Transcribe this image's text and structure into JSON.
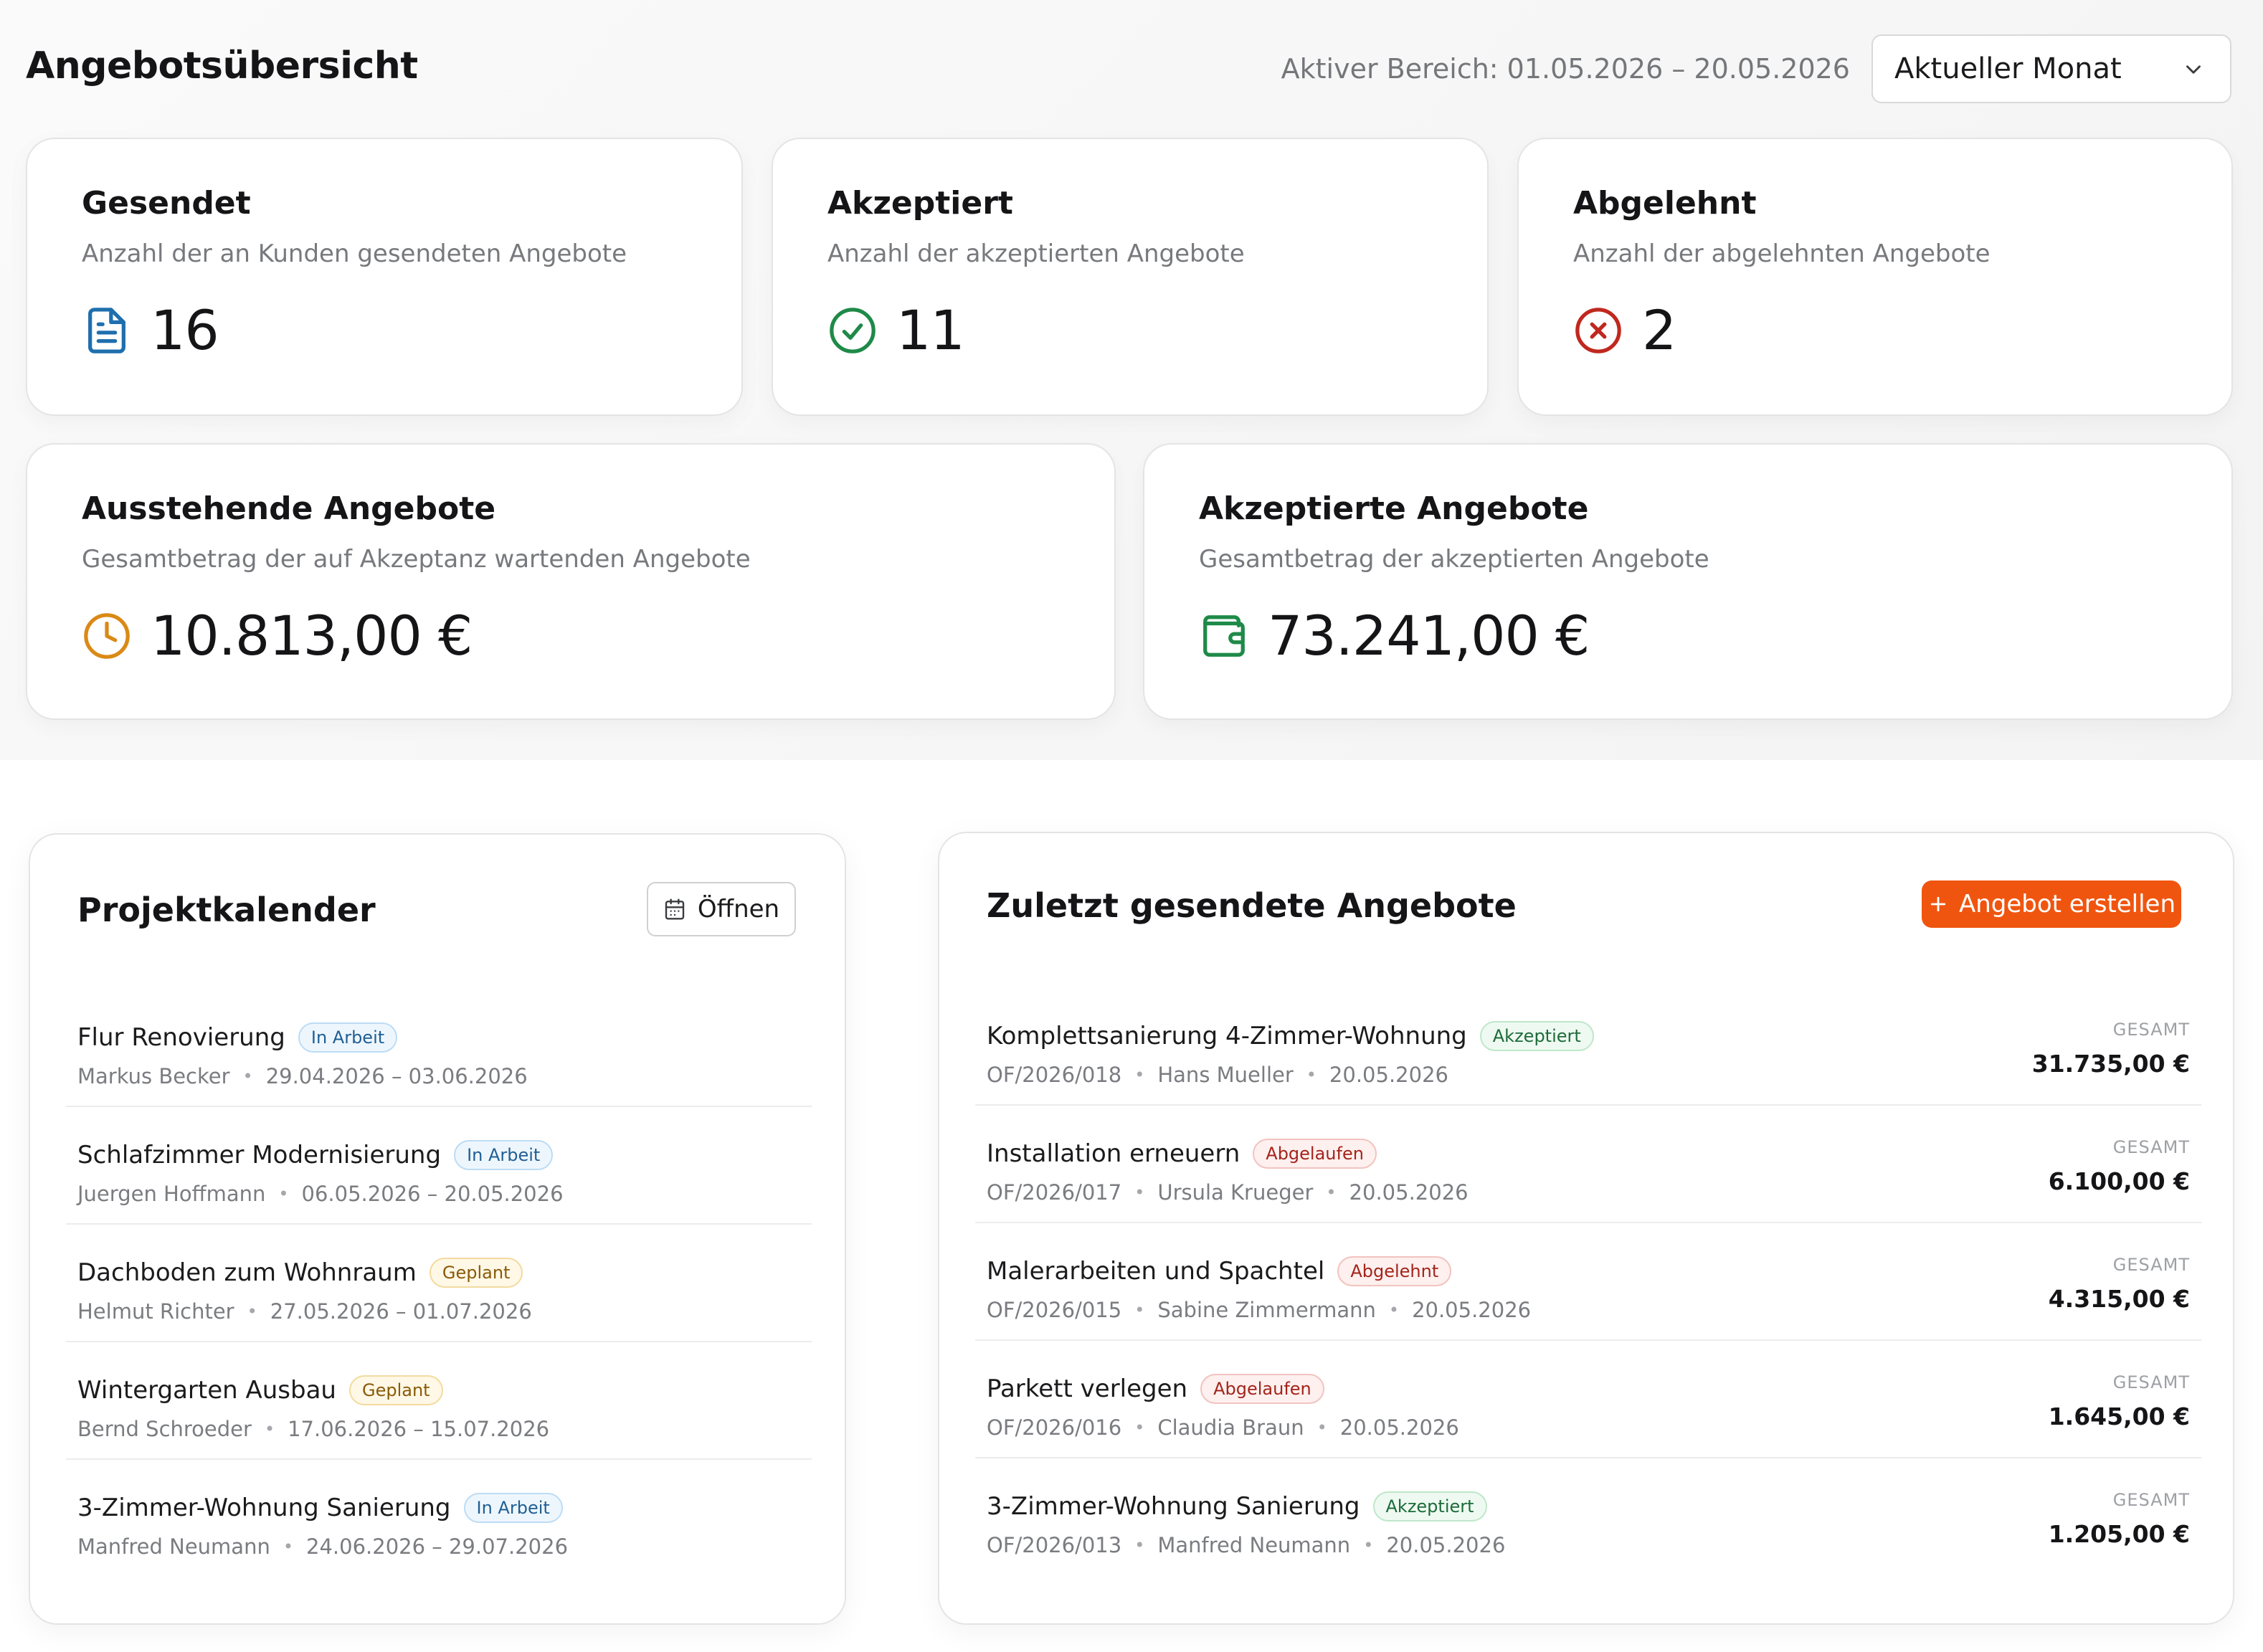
{
  "header": {
    "title": "Angebotsübersicht",
    "range_label": "Aktiver Bereich: 01.05.2026 – 20.05.2026",
    "period_select": "Aktueller Monat"
  },
  "stats": [
    {
      "title": "Gesendet",
      "subtitle": "Anzahl der an Kunden gesendeten Angebote",
      "value": "16",
      "icon": "document-icon",
      "color": "#1f6fae"
    },
    {
      "title": "Akzeptiert",
      "subtitle": "Anzahl der akzeptierten Angebote",
      "value": "11",
      "icon": "check-circle-icon",
      "color": "#1f8a48"
    },
    {
      "title": "Abgelehnt",
      "subtitle": "Anzahl der abgelehnten Angebote",
      "value": "2",
      "icon": "x-circle-icon",
      "color": "#c0281e"
    },
    {
      "title": "Ausstehende Angebote",
      "subtitle": "Gesamtbetrag der auf Akzeptanz wartenden Angebote",
      "value": "10.813,00 €",
      "icon": "clock-icon",
      "color": "#d98a16"
    },
    {
      "title": "Akzeptierte Angebote",
      "subtitle": "Gesamtbetrag der akzeptierten Angebote",
      "value": "73.241,00 €",
      "icon": "wallet-icon",
      "color": "#1f8a48"
    }
  ],
  "calendar": {
    "title": "Projektkalender",
    "open_label": "Öffnen",
    "items": [
      {
        "name": "Flur Renovierung",
        "status": "In Arbeit",
        "person": "Markus Becker",
        "dates": "29.04.2026 – 03.06.2026"
      },
      {
        "name": "Schlafzimmer Modernisierung",
        "status": "In Arbeit",
        "person": "Juergen Hoffmann",
        "dates": "06.05.2026 – 20.05.2026"
      },
      {
        "name": "Dachboden zum Wohnraum",
        "status": "Geplant",
        "person": "Helmut Richter",
        "dates": "27.05.2026 – 01.07.2026"
      },
      {
        "name": "Wintergarten Ausbau",
        "status": "Geplant",
        "person": "Bernd Schroeder",
        "dates": "17.06.2026 – 15.07.2026"
      },
      {
        "name": "3-Zimmer-Wohnung Sanierung",
        "status": "In Arbeit",
        "person": "Manfred Neumann",
        "dates": "24.06.2026 – 29.07.2026"
      }
    ]
  },
  "offers": {
    "title": "Zuletzt gesendete Angebote",
    "create_label": "Angebot erstellen",
    "total_label": "GESAMT",
    "items": [
      {
        "name": "Komplettsanierung 4-Zimmer-Wohnung",
        "status": "Akzeptiert",
        "number": "OF/2026/018",
        "customer": "Hans Mueller",
        "date": "20.05.2026",
        "total": "31.735,00 €"
      },
      {
        "name": "Installation erneuern",
        "status": "Abgelaufen",
        "number": "OF/2026/017",
        "customer": "Ursula Krueger",
        "date": "20.05.2026",
        "total": "6.100,00 €"
      },
      {
        "name": "Malerarbeiten und Spachtel",
        "status": "Abgelehnt",
        "number": "OF/2026/015",
        "customer": "Sabine Zimmermann",
        "date": "20.05.2026",
        "total": "4.315,00 €"
      },
      {
        "name": "Parkett verlegen",
        "status": "Abgelaufen",
        "number": "OF/2026/016",
        "customer": "Claudia Braun",
        "date": "20.05.2026",
        "total": "1.645,00 €"
      },
      {
        "name": "3-Zimmer-Wohnung Sanierung",
        "status": "Akzeptiert",
        "number": "OF/2026/013",
        "customer": "Manfred Neumann",
        "date": "20.05.2026",
        "total": "1.205,00 €"
      }
    ]
  },
  "colors": {
    "accent": "#f0550f",
    "status_in_arbeit": "#1f5f93",
    "status_geplant": "#8a5a08",
    "status_akzeptiert": "#1d6b39",
    "status_abgelehnt": "#a4241a"
  }
}
